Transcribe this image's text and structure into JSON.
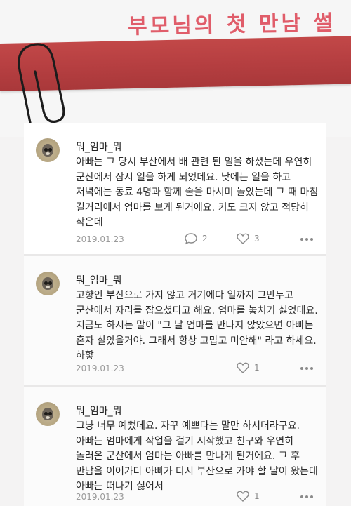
{
  "page": {
    "title": "부모님의 첫 만남 썰"
  },
  "colors": {
    "ribbon": "#b63f41",
    "title": "#e05d6a",
    "meta": "#8a8a8a"
  },
  "comments": [
    {
      "username": "뭐_임마_뭐",
      "text": "아빠는 그 당시 부산에서 배 관련 된 일을 하셨는데 우연히 군산에서 잠시 일을 하게 되었데요. 낮에는 일을 하고 저녁에는 동료 4명과 함께 술을 마시며 놀았는데 그 때 마침 길거리에서 엄마를 보게 된거에요. 키도 크지 않고 적당히 작은데",
      "date": "2019.01.23",
      "reply_count": "2",
      "like_count": "3"
    },
    {
      "username": "뭐_임마_뭐",
      "text": "고향인 부산으로 가지 않고 거기에다 일까지 그만두고 군산에서 자리를 잡으셨다고 해요. 엄마를 놓치기 싫었데요. 지금도 하시는 말이 \"그 날 엄마를 만나지 않았으면 아빠는 혼자 살았을거야. 그래서 항상 고맙고 미안해\" 라고 하세요. 하핳",
      "date": "2019.01.23",
      "like_count": "1"
    },
    {
      "username": "뭐_임마_뭐",
      "text": "그냥 너무 예뻤데요. 자꾸 예쁘다는 말만 하시더라구요. 아빠는 엄마에게 작업을 걸기 시작했고 친구와 우연히 놀러온 군산에서 엄마는 아빠를 만나게 된거에요. 그 후 만남을 이어가다 아빠가 다시 부산으로 가야 할 날이 왔는데 아빠는 떠나기 싫어서",
      "date": "2019.01.23",
      "like_count": "1"
    }
  ]
}
